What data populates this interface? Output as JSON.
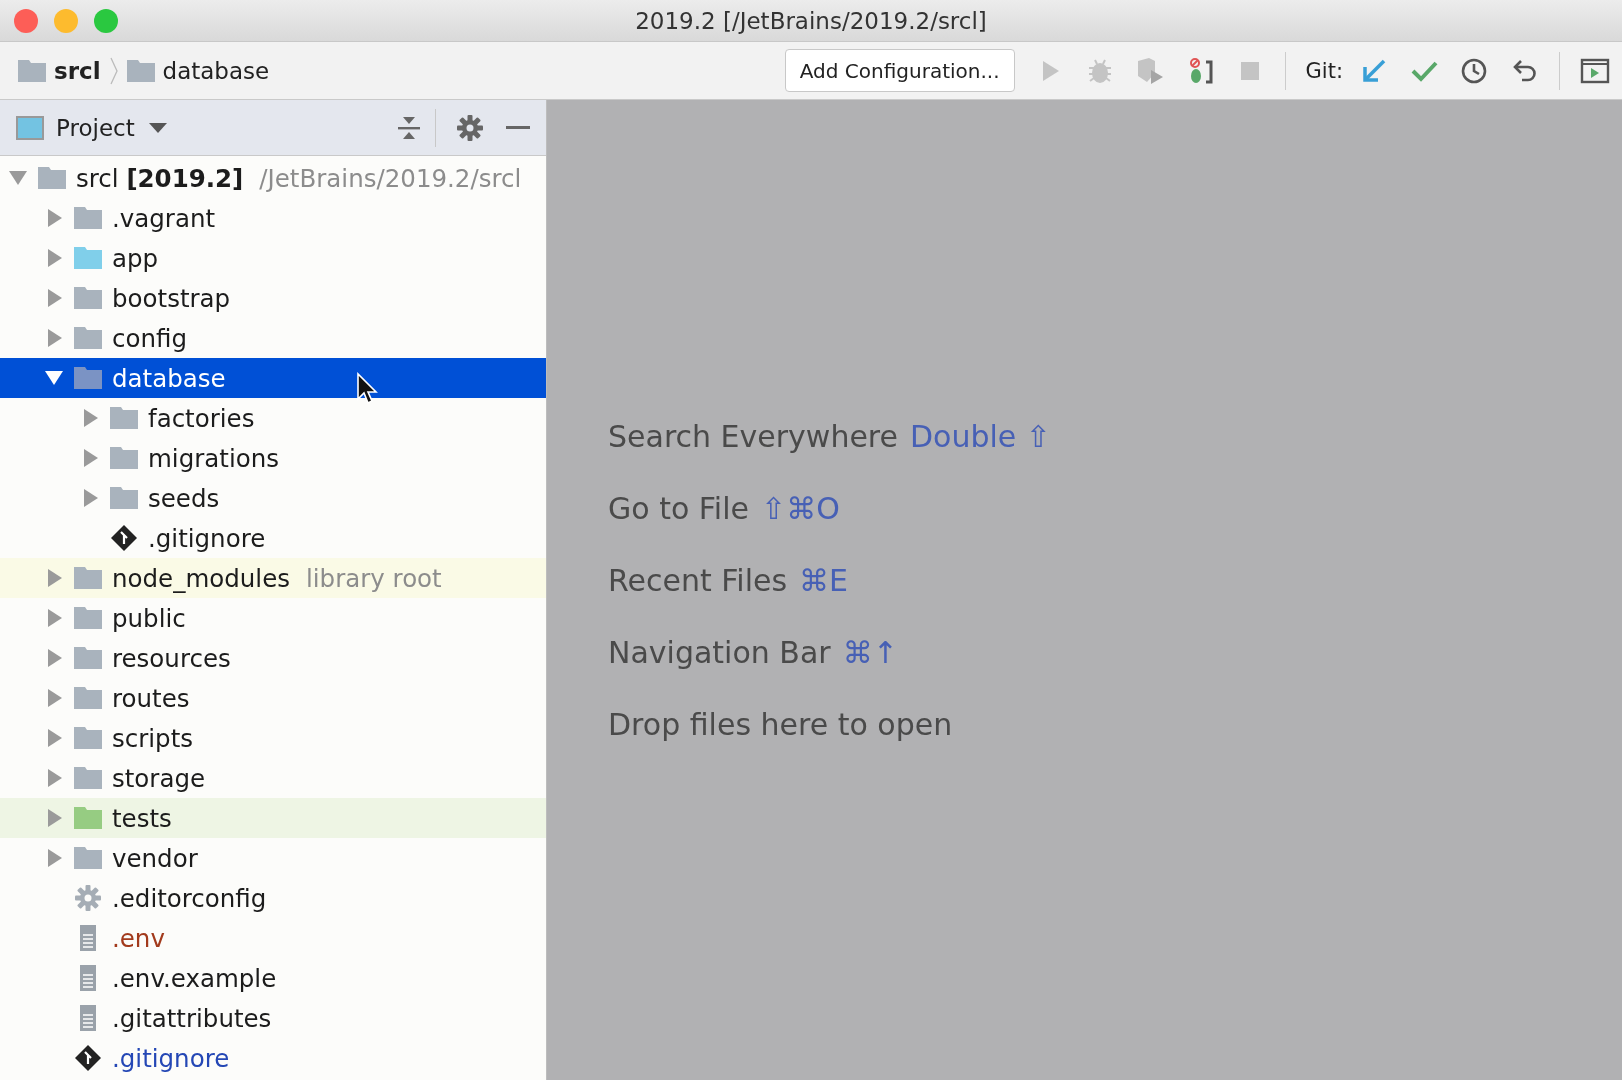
{
  "window": {
    "title": "2019.2 [/JetBrains/2019.2/srcl]"
  },
  "breadcrumbs": [
    {
      "label": "srcl",
      "bold": true
    },
    {
      "label": "database",
      "bold": false
    }
  ],
  "toolbar": {
    "config_button": "Add Configuration...",
    "items": [
      {
        "kind": "run",
        "disabled": true
      },
      {
        "kind": "debug",
        "disabled": true
      },
      {
        "kind": "coverage",
        "disabled": true
      },
      {
        "kind": "profile",
        "disabled": false
      },
      {
        "kind": "stop",
        "disabled": true
      },
      {
        "kind": "separator"
      },
      {
        "kind": "label",
        "text": "Git:"
      },
      {
        "kind": "update",
        "disabled": false
      },
      {
        "kind": "commit",
        "disabled": false
      },
      {
        "kind": "history",
        "disabled": false
      },
      {
        "kind": "revert",
        "disabled": false
      },
      {
        "kind": "separator"
      },
      {
        "kind": "panel",
        "disabled": false
      }
    ]
  },
  "project_panel": {
    "title": "Project"
  },
  "tree": [
    {
      "label": "srcl **[2019.2]**",
      "path": "/JetBrains/2019.2/srcl",
      "kind": "folder",
      "expanded": true,
      "selected": false,
      "children": [
        {
          "label": ".vagrant",
          "kind": "folder",
          "expanded": false,
          "selected": false
        },
        {
          "label": "app",
          "kind": "source",
          "expanded": false,
          "selected": false
        },
        {
          "label": "bootstrap",
          "kind": "folder",
          "expanded": false,
          "selected": false
        },
        {
          "label": "config",
          "kind": "folder",
          "expanded": false,
          "selected": false
        },
        {
          "label": "database",
          "kind": "folder",
          "expanded": true,
          "selected": true,
          "children": [
            {
              "label": "factories",
              "kind": "folder",
              "expanded": false,
              "selected": false
            },
            {
              "label": "migrations",
              "kind": "folder",
              "expanded": false,
              "selected": false
            },
            {
              "label": "seeds",
              "kind": "folder",
              "expanded": false,
              "selected": false
            },
            {
              "label": ".gitignore",
              "kind": "git",
              "selected": false
            }
          ]
        },
        {
          "label": "node_modules",
          "suffix": "library root",
          "kind": "library",
          "expanded": false,
          "selected": false
        },
        {
          "label": "public",
          "kind": "folder",
          "expanded": false,
          "selected": false
        },
        {
          "label": "resources",
          "kind": "folder",
          "expanded": false,
          "selected": false
        },
        {
          "label": "routes",
          "kind": "folder",
          "expanded": false,
          "selected": false
        },
        {
          "label": "scripts",
          "kind": "folder",
          "expanded": false,
          "selected": false
        },
        {
          "label": "storage",
          "kind": "folder",
          "expanded": false,
          "selected": false
        },
        {
          "label": "tests",
          "kind": "test",
          "expanded": false,
          "selected": false
        },
        {
          "label": "vendor",
          "kind": "folder",
          "expanded": false,
          "selected": false
        },
        {
          "label": ".editorconfig",
          "kind": "config",
          "selected": false
        },
        {
          "label": ".env",
          "kind": "text",
          "color": "#a23a1c",
          "selected": false
        },
        {
          "label": ".env.example",
          "kind": "text",
          "selected": false
        },
        {
          "label": ".gitattributes",
          "kind": "text",
          "selected": false
        },
        {
          "label": ".gitignore",
          "kind": "git",
          "color": "#2447b5",
          "selected": false
        }
      ]
    }
  ],
  "hints": [
    {
      "text": "Search Everywhere",
      "keys": "Double ⇧"
    },
    {
      "text": "Go to File",
      "keys": "⇧⌘O"
    },
    {
      "text": "Recent Files",
      "keys": "⌘E"
    },
    {
      "text": "Navigation Bar",
      "keys": "⌘↑"
    },
    {
      "text": "Drop files here to open"
    }
  ]
}
